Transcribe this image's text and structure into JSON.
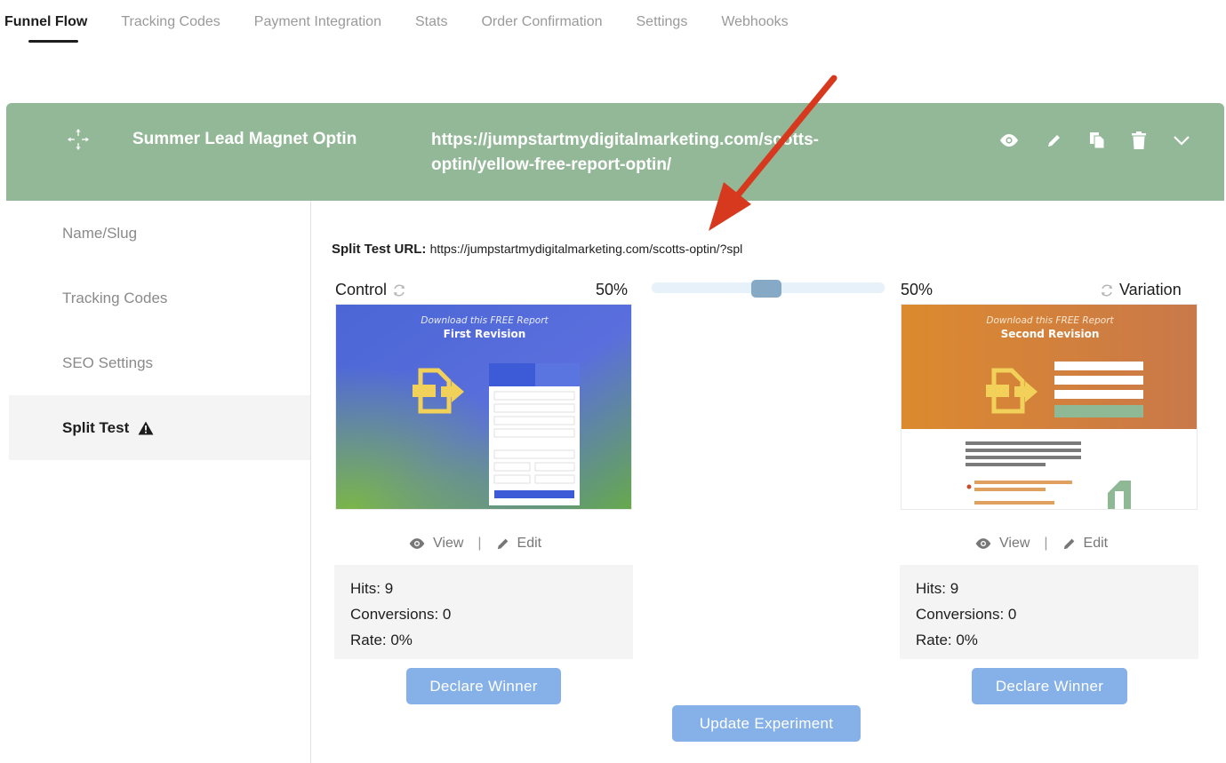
{
  "tabs": [
    {
      "label": "Funnel Flow",
      "active": true
    },
    {
      "label": "Tracking Codes"
    },
    {
      "label": "Payment Integration"
    },
    {
      "label": "Stats"
    },
    {
      "label": "Order Confirmation"
    },
    {
      "label": "Settings"
    },
    {
      "label": "Webhooks"
    }
  ],
  "step": {
    "name": "Summer Lead Magnet Optin",
    "url": "https://jumpstartmydigitalmarketing.com/scotts-optin/yellow-free-report-optin/",
    "header_color": "#93b897",
    "actions": [
      "eye-icon",
      "pencil-icon",
      "copy-icon",
      "trash-icon",
      "chevron-down-icon"
    ]
  },
  "sidebar": {
    "items": [
      {
        "label": "Name/Slug"
      },
      {
        "label": "Tracking Codes"
      },
      {
        "label": "SEO Settings"
      },
      {
        "label": "Split Test",
        "active": true,
        "icon": "warning-icon"
      }
    ]
  },
  "split_test": {
    "url_label": "Split Test URL:",
    "url_value": "https://jumpstartmydigitalmarketing.com/scotts-optin/?spl",
    "traffic_split": 0.5,
    "control": {
      "label": "Control",
      "percent": "50%",
      "preview_line1": "Download this FREE Report",
      "preview_line2": "First Revision",
      "view_label": "View",
      "edit_label": "Edit",
      "separator": "|",
      "hits": "Hits: 9",
      "conversions": "Conversions: 0",
      "rate": "Rate: 0%",
      "winner_label": "Declare Winner"
    },
    "variation": {
      "label": "Variation",
      "percent": "50%",
      "preview_line1": "Download this FREE Report",
      "preview_line2": "Second Revision",
      "view_label": "View",
      "edit_label": "Edit",
      "separator": "|",
      "hits": "Hits: 9",
      "conversions": "Conversions: 0",
      "rate": "Rate: 0%",
      "winner_label": "Declare Winner"
    },
    "update_label": "Update Experiment"
  },
  "colors": {
    "accent_button": "#86b1e8",
    "annotation_arrow": "#d7391f",
    "slider_thumb": "#86a9c6"
  }
}
